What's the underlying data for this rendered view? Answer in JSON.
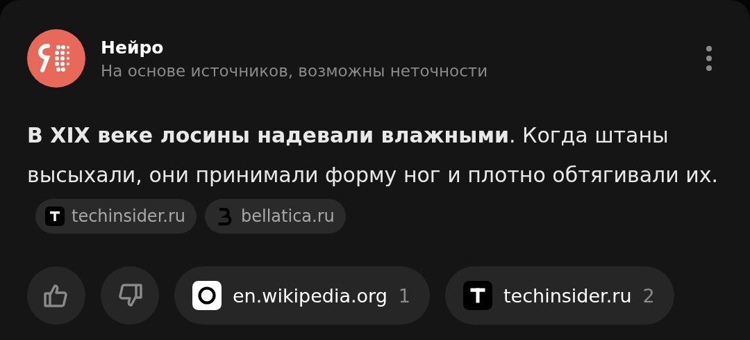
{
  "header": {
    "title": "Нейро",
    "subtitle": "На основе источников, возможны неточности"
  },
  "answer": {
    "text": "**В XIX веке лосины надевали влажными**. Когда штаны высыхали, они принимали форму ног и плотно обтягивали их.",
    "sources": [
      {
        "label": "techinsider.ru",
        "kind": "square"
      },
      {
        "label": "bellatica.ru",
        "kind": "mark"
      }
    ]
  },
  "feedback": [
    {
      "kind": "like"
    },
    {
      "kind": "dislike"
    }
  ],
  "source_cards": [
    {
      "label": "en.wikipedia.org",
      "count": "1",
      "kind": "light"
    },
    {
      "label": "techinsider.ru",
      "count": "2",
      "kind": "square"
    }
  ]
}
